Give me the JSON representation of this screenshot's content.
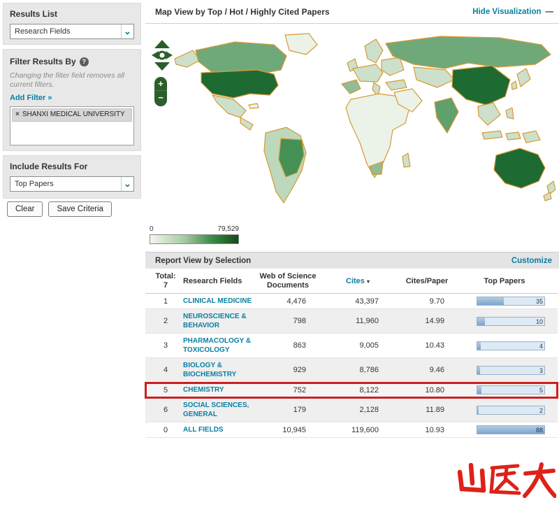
{
  "colors": {
    "accent_teal": "#0b7ea1",
    "highlight_red": "#ce1f1f",
    "bar_fill_blue": "#7da5cc",
    "bar_track_blue": "#dde9f4",
    "map_dark_green": "#1d6a32",
    "map_medium_green": "#6fa97a",
    "map_light_green": "#cde0cb",
    "map_pale_green": "#ebf2e8",
    "map_border_orange": "#d89a33",
    "logo_red": "#dd2218"
  },
  "icons": {
    "chevron_down": "⌄",
    "help": "?",
    "remove": "×",
    "sort_desc": "▾",
    "collapse_minus": "—"
  },
  "sidebar": {
    "results_list_label": "Results List",
    "results_list_value": "Research Fields",
    "filter_label": "Filter Results By",
    "filter_note": "Changing the filter field removes all current filters.",
    "add_filter_label": "Add Filter »",
    "active_filter_name": "SHANXI MEDICAL UNIVERSITY",
    "include_label": "Include Results For",
    "include_value": "Top Papers",
    "clear_label": "Clear",
    "save_label": "Save Criteria"
  },
  "map": {
    "title": "Map View by Top / Hot / Highly Cited Papers",
    "hide_label": "Hide Visualization",
    "legend_min": "0",
    "legend_max": "79,529",
    "zoom_in": "+",
    "zoom_out": "−"
  },
  "report": {
    "section_title": "Report View by Selection",
    "customize_label": "Customize",
    "total_label": "Total:",
    "total_value": "7",
    "columns": {
      "field": "Research Fields",
      "docs": "Web of Science Documents",
      "cites": "Cites",
      "cpp": "Cites/Paper",
      "top": "Top Papers"
    },
    "rows": [
      {
        "rank": "1",
        "field": "CLINICAL MEDICINE",
        "docs": "4,476",
        "cites": "43,397",
        "cpp": "9.70",
        "top": "35",
        "bar_pct": "40"
      },
      {
        "rank": "2",
        "field": "NEUROSCIENCE & BEHAVIOR",
        "docs": "798",
        "cites": "11,960",
        "cpp": "14.99",
        "top": "10",
        "bar_pct": "11"
      },
      {
        "rank": "3",
        "field": "PHARMACOLOGY & TOXICOLOGY",
        "docs": "863",
        "cites": "9,005",
        "cpp": "10.43",
        "top": "4",
        "bar_pct": "5"
      },
      {
        "rank": "4",
        "field": "BIOLOGY & BIOCHEMISTRY",
        "docs": "929",
        "cites": "8,786",
        "cpp": "9.46",
        "top": "3",
        "bar_pct": "4"
      },
      {
        "rank": "5",
        "field": "CHEMISTRY",
        "docs": "752",
        "cites": "8,122",
        "cpp": "10.80",
        "top": "5",
        "bar_pct": "6"
      },
      {
        "rank": "6",
        "field": "SOCIAL SCIENCES, GENERAL",
        "docs": "179",
        "cites": "2,128",
        "cpp": "11.89",
        "top": "2",
        "bar_pct": "2"
      },
      {
        "rank": "0",
        "field": "ALL FIELDS",
        "docs": "10,945",
        "cites": "119,600",
        "cpp": "10.93",
        "top": "88",
        "bar_pct": "100"
      }
    ]
  },
  "logo_text": "山医大"
}
